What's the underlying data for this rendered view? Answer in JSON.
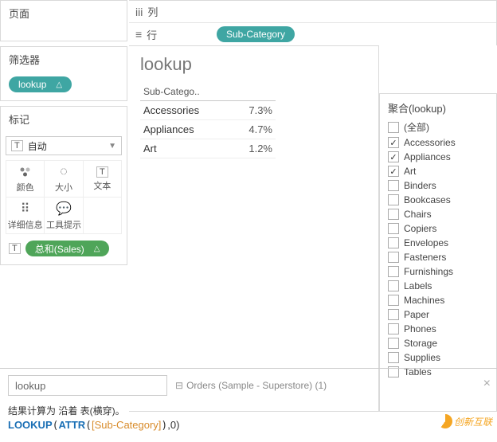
{
  "pages": {
    "title": "页面"
  },
  "shelves": {
    "columns_label": "列",
    "rows_label": "行",
    "rows_pill": "Sub-Category"
  },
  "filters": {
    "title": "筛选器",
    "pill": "lookup"
  },
  "marks": {
    "title": "标记",
    "type_label": "自动",
    "cells": {
      "color": "颜色",
      "size": "大小",
      "text": "文本",
      "detail": "详细信息",
      "tooltip": "工具提示"
    },
    "pill": "总和(Sales)"
  },
  "viz": {
    "title": "lookup",
    "header": "Sub-Catego..",
    "rows": [
      {
        "cat": "Accessories",
        "val": "7.3%"
      },
      {
        "cat": "Appliances",
        "val": "4.7%"
      },
      {
        "cat": "Art",
        "val": "1.2%"
      }
    ]
  },
  "aggregate": {
    "title": "聚合(lookup)",
    "items": [
      {
        "label": "(全部)",
        "checked": false
      },
      {
        "label": "Accessories",
        "checked": true
      },
      {
        "label": "Appliances",
        "checked": true
      },
      {
        "label": "Art",
        "checked": true
      },
      {
        "label": "Binders",
        "checked": false
      },
      {
        "label": "Bookcases",
        "checked": false
      },
      {
        "label": "Chairs",
        "checked": false
      },
      {
        "label": "Copiers",
        "checked": false
      },
      {
        "label": "Envelopes",
        "checked": false
      },
      {
        "label": "Fasteners",
        "checked": false
      },
      {
        "label": "Furnishings",
        "checked": false
      },
      {
        "label": "Labels",
        "checked": false
      },
      {
        "label": "Machines",
        "checked": false
      },
      {
        "label": "Paper",
        "checked": false
      },
      {
        "label": "Phones",
        "checked": false
      },
      {
        "label": "Storage",
        "checked": false
      },
      {
        "label": "Supplies",
        "checked": false
      },
      {
        "label": "Tables",
        "checked": false
      }
    ]
  },
  "formula": {
    "name": "lookup",
    "source": "Orders (Sample - Superstore) (1)",
    "result_text": "结果计算为 沿着 表(横穿)。",
    "fn": "LOOKUP",
    "inner_fn": "ATTR",
    "field": "[Sub-Category]",
    "args_tail": ",0)"
  },
  "watermark": "创新互联"
}
